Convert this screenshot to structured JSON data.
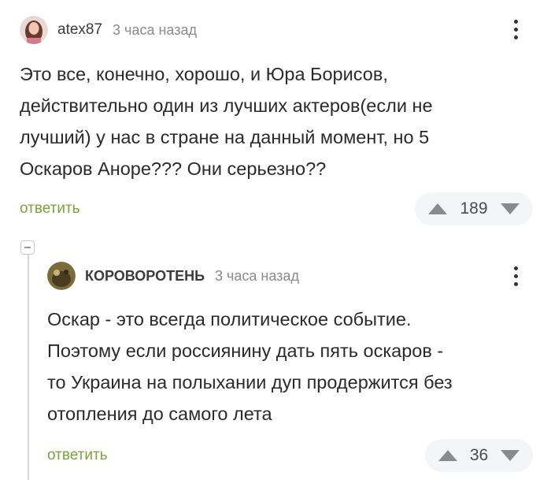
{
  "comment1": {
    "username": "atex87",
    "time": "3 часа назад",
    "lines": [
      "Это все, конечно, хорошо, и Юра Борисов,",
      "действительно один из лучших актеров(если не",
      "лучший) у нас в стране на данный момент, но 5",
      "Оскаров Аноре??? Они серьезно??"
    ],
    "reply_label": "ответить",
    "rating": "189"
  },
  "comment2": {
    "username": "КОРОВОРОТЕНЬ",
    "time": "3 часа назад",
    "lines": [
      "Оскар - это всегда политическое событие.",
      "Поэтому если россиянину дать пять оскаров -",
      "то Украина на полыхании дуп продержится без",
      "отопления до самого лета"
    ],
    "reply_label": "ответить",
    "rating": "36"
  },
  "colors": {
    "accent_green": "#7aa33a",
    "muted": "#8a8a8a",
    "rating_bg": "#f4f5f7"
  },
  "icons": [
    "user-avatar",
    "more-vertical-icon",
    "upvote-icon",
    "downvote-icon",
    "collapse-thread-icon"
  ]
}
